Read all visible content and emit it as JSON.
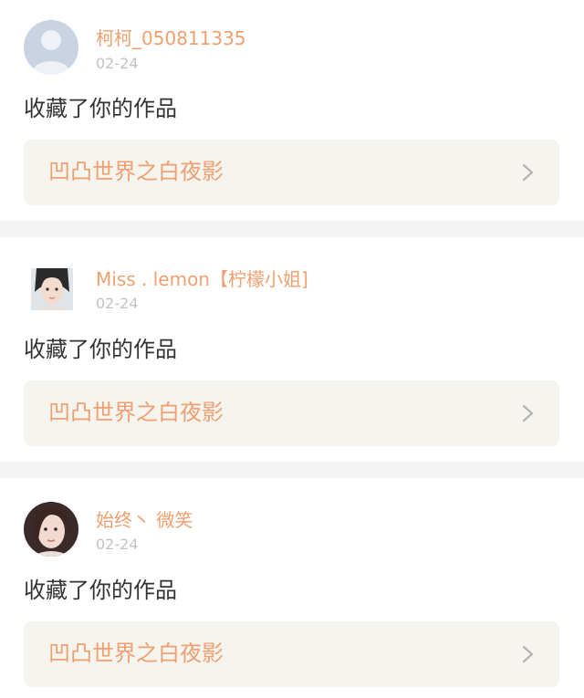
{
  "notifications": [
    {
      "user": "柯柯_050811335",
      "date": "02-24",
      "action": "收藏了你的作品",
      "work_title": "凹凸世界之白夜影",
      "avatar_icon": "default-avatar-icon"
    },
    {
      "user": "Miss . lemon【柠檬小姐]",
      "date": "02-24",
      "action": "收藏了你的作品",
      "work_title": "凹凸世界之白夜影",
      "avatar_icon": "user-photo-avatar"
    },
    {
      "user": "始终丶 微笑",
      "date": "02-24",
      "action": "收藏了你的作品",
      "work_title": "凹凸世界之白夜影",
      "avatar_icon": "user-photo-avatar"
    }
  ],
  "colors": {
    "accent": "#f0a070",
    "date": "#c2c2c2",
    "text": "#333333",
    "work_bg": "#f5f4ef",
    "separator": "#f4f4f4"
  }
}
